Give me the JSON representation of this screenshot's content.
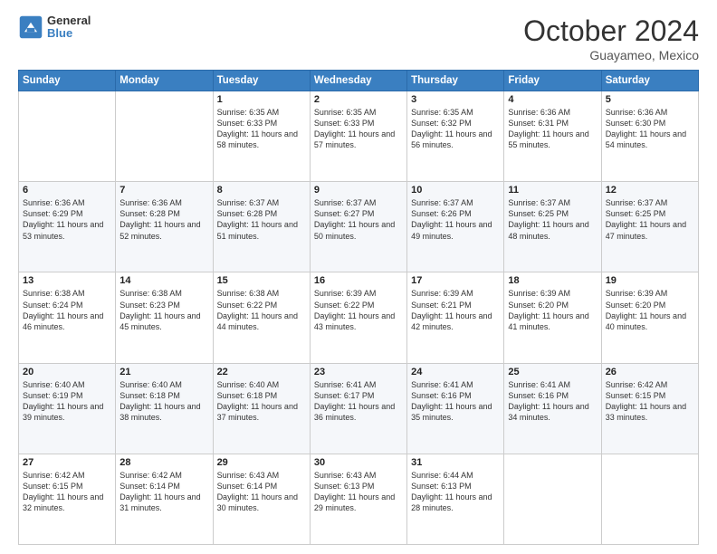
{
  "header": {
    "logo_general": "General",
    "logo_blue": "Blue",
    "month_title": "October 2024",
    "location": "Guayameo, Mexico"
  },
  "days_of_week": [
    "Sunday",
    "Monday",
    "Tuesday",
    "Wednesday",
    "Thursday",
    "Friday",
    "Saturday"
  ],
  "weeks": [
    [
      {
        "day": "",
        "sunrise": "",
        "sunset": "",
        "daylight": ""
      },
      {
        "day": "",
        "sunrise": "",
        "sunset": "",
        "daylight": ""
      },
      {
        "day": "1",
        "sunrise": "Sunrise: 6:35 AM",
        "sunset": "Sunset: 6:33 PM",
        "daylight": "Daylight: 11 hours and 58 minutes."
      },
      {
        "day": "2",
        "sunrise": "Sunrise: 6:35 AM",
        "sunset": "Sunset: 6:33 PM",
        "daylight": "Daylight: 11 hours and 57 minutes."
      },
      {
        "day": "3",
        "sunrise": "Sunrise: 6:35 AM",
        "sunset": "Sunset: 6:32 PM",
        "daylight": "Daylight: 11 hours and 56 minutes."
      },
      {
        "day": "4",
        "sunrise": "Sunrise: 6:36 AM",
        "sunset": "Sunset: 6:31 PM",
        "daylight": "Daylight: 11 hours and 55 minutes."
      },
      {
        "day": "5",
        "sunrise": "Sunrise: 6:36 AM",
        "sunset": "Sunset: 6:30 PM",
        "daylight": "Daylight: 11 hours and 54 minutes."
      }
    ],
    [
      {
        "day": "6",
        "sunrise": "Sunrise: 6:36 AM",
        "sunset": "Sunset: 6:29 PM",
        "daylight": "Daylight: 11 hours and 53 minutes."
      },
      {
        "day": "7",
        "sunrise": "Sunrise: 6:36 AM",
        "sunset": "Sunset: 6:28 PM",
        "daylight": "Daylight: 11 hours and 52 minutes."
      },
      {
        "day": "8",
        "sunrise": "Sunrise: 6:37 AM",
        "sunset": "Sunset: 6:28 PM",
        "daylight": "Daylight: 11 hours and 51 minutes."
      },
      {
        "day": "9",
        "sunrise": "Sunrise: 6:37 AM",
        "sunset": "Sunset: 6:27 PM",
        "daylight": "Daylight: 11 hours and 50 minutes."
      },
      {
        "day": "10",
        "sunrise": "Sunrise: 6:37 AM",
        "sunset": "Sunset: 6:26 PM",
        "daylight": "Daylight: 11 hours and 49 minutes."
      },
      {
        "day": "11",
        "sunrise": "Sunrise: 6:37 AM",
        "sunset": "Sunset: 6:25 PM",
        "daylight": "Daylight: 11 hours and 48 minutes."
      },
      {
        "day": "12",
        "sunrise": "Sunrise: 6:37 AM",
        "sunset": "Sunset: 6:25 PM",
        "daylight": "Daylight: 11 hours and 47 minutes."
      }
    ],
    [
      {
        "day": "13",
        "sunrise": "Sunrise: 6:38 AM",
        "sunset": "Sunset: 6:24 PM",
        "daylight": "Daylight: 11 hours and 46 minutes."
      },
      {
        "day": "14",
        "sunrise": "Sunrise: 6:38 AM",
        "sunset": "Sunset: 6:23 PM",
        "daylight": "Daylight: 11 hours and 45 minutes."
      },
      {
        "day": "15",
        "sunrise": "Sunrise: 6:38 AM",
        "sunset": "Sunset: 6:22 PM",
        "daylight": "Daylight: 11 hours and 44 minutes."
      },
      {
        "day": "16",
        "sunrise": "Sunrise: 6:39 AM",
        "sunset": "Sunset: 6:22 PM",
        "daylight": "Daylight: 11 hours and 43 minutes."
      },
      {
        "day": "17",
        "sunrise": "Sunrise: 6:39 AM",
        "sunset": "Sunset: 6:21 PM",
        "daylight": "Daylight: 11 hours and 42 minutes."
      },
      {
        "day": "18",
        "sunrise": "Sunrise: 6:39 AM",
        "sunset": "Sunset: 6:20 PM",
        "daylight": "Daylight: 11 hours and 41 minutes."
      },
      {
        "day": "19",
        "sunrise": "Sunrise: 6:39 AM",
        "sunset": "Sunset: 6:20 PM",
        "daylight": "Daylight: 11 hours and 40 minutes."
      }
    ],
    [
      {
        "day": "20",
        "sunrise": "Sunrise: 6:40 AM",
        "sunset": "Sunset: 6:19 PM",
        "daylight": "Daylight: 11 hours and 39 minutes."
      },
      {
        "day": "21",
        "sunrise": "Sunrise: 6:40 AM",
        "sunset": "Sunset: 6:18 PM",
        "daylight": "Daylight: 11 hours and 38 minutes."
      },
      {
        "day": "22",
        "sunrise": "Sunrise: 6:40 AM",
        "sunset": "Sunset: 6:18 PM",
        "daylight": "Daylight: 11 hours and 37 minutes."
      },
      {
        "day": "23",
        "sunrise": "Sunrise: 6:41 AM",
        "sunset": "Sunset: 6:17 PM",
        "daylight": "Daylight: 11 hours and 36 minutes."
      },
      {
        "day": "24",
        "sunrise": "Sunrise: 6:41 AM",
        "sunset": "Sunset: 6:16 PM",
        "daylight": "Daylight: 11 hours and 35 minutes."
      },
      {
        "day": "25",
        "sunrise": "Sunrise: 6:41 AM",
        "sunset": "Sunset: 6:16 PM",
        "daylight": "Daylight: 11 hours and 34 minutes."
      },
      {
        "day": "26",
        "sunrise": "Sunrise: 6:42 AM",
        "sunset": "Sunset: 6:15 PM",
        "daylight": "Daylight: 11 hours and 33 minutes."
      }
    ],
    [
      {
        "day": "27",
        "sunrise": "Sunrise: 6:42 AM",
        "sunset": "Sunset: 6:15 PM",
        "daylight": "Daylight: 11 hours and 32 minutes."
      },
      {
        "day": "28",
        "sunrise": "Sunrise: 6:42 AM",
        "sunset": "Sunset: 6:14 PM",
        "daylight": "Daylight: 11 hours and 31 minutes."
      },
      {
        "day": "29",
        "sunrise": "Sunrise: 6:43 AM",
        "sunset": "Sunset: 6:14 PM",
        "daylight": "Daylight: 11 hours and 30 minutes."
      },
      {
        "day": "30",
        "sunrise": "Sunrise: 6:43 AM",
        "sunset": "Sunset: 6:13 PM",
        "daylight": "Daylight: 11 hours and 29 minutes."
      },
      {
        "day": "31",
        "sunrise": "Sunrise: 6:44 AM",
        "sunset": "Sunset: 6:13 PM",
        "daylight": "Daylight: 11 hours and 28 minutes."
      },
      {
        "day": "",
        "sunrise": "",
        "sunset": "",
        "daylight": ""
      },
      {
        "day": "",
        "sunrise": "",
        "sunset": "",
        "daylight": ""
      }
    ]
  ]
}
